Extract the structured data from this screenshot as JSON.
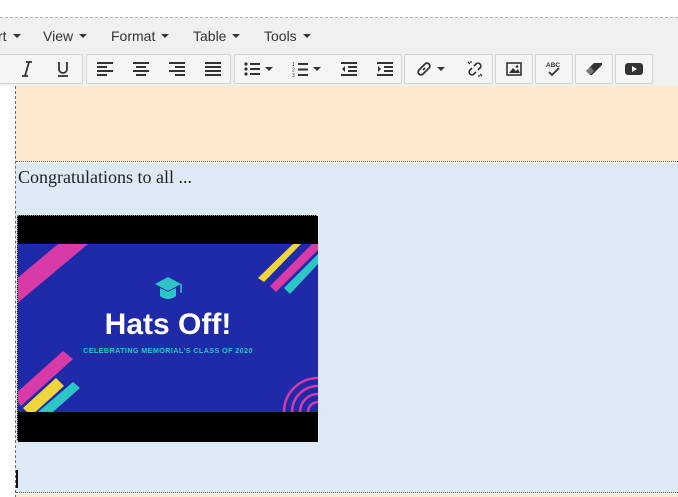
{
  "menubar": {
    "items": [
      {
        "label": "rt"
      },
      {
        "label": "View"
      },
      {
        "label": "Format"
      },
      {
        "label": "Table"
      },
      {
        "label": "Tools"
      }
    ]
  },
  "toolbar": {
    "buttons": [
      "italic-icon",
      "underline-icon",
      "align-left-icon",
      "align-center-icon",
      "align-right-icon",
      "align-justify-icon",
      "bullet-list-icon",
      "numbered-list-icon",
      "outdent-icon",
      "indent-icon",
      "link-icon",
      "unlink-icon",
      "image-icon",
      "spellcheck-icon",
      "eraser-icon",
      "youtube-icon"
    ]
  },
  "content": {
    "text": "Congratulations to all ...",
    "media": {
      "title": "Hats Off!",
      "subtitle": "CELEBRATING MEMORIAL'S CLASS OF 2020"
    }
  },
  "colors": {
    "peach": "#fde8d0",
    "blue_bg": "#dde9f4",
    "banner_blue": "#1e2aa8",
    "accent_yellow": "#f2d43b",
    "accent_pink": "#d83aa8",
    "accent_teal": "#2cc6c6"
  }
}
